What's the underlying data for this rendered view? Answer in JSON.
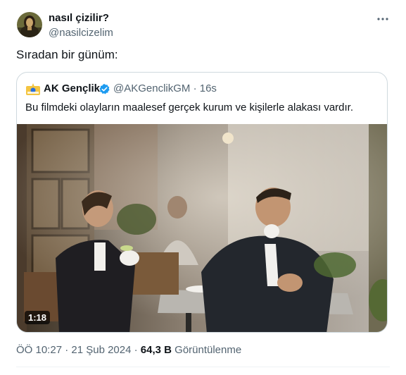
{
  "author": {
    "name": "nasıl çizilir?",
    "handle": "@nasilcizelim",
    "avatar_icon": "mona-lisa-avatar"
  },
  "post": {
    "text": "Sıradan bir günüm:"
  },
  "quoted": {
    "name": "AK Gençlik",
    "handle_time": "@AKGenclikGM · 16s",
    "text": "Bu filmdeki olayların maalesef gerçek kurum ve kişilerle alakası vardır.",
    "verified_color": "#1d9bf0",
    "video_duration": "1:18"
  },
  "meta": {
    "time_date": "ÖÖ 10:27 · 21 Şub 2024 · ",
    "views_count": "64,3 B",
    "views_label": " Görüntülenme"
  },
  "colors": {
    "text": "#0f1419",
    "secondary": "#536471",
    "border": "#cfd9de"
  }
}
